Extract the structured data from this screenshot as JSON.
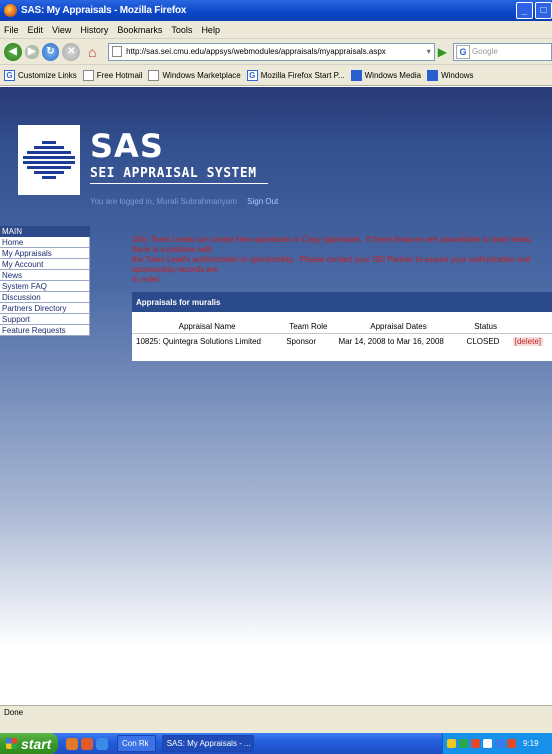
{
  "window": {
    "title": "SAS: My Appraisals - Mozilla Firefox"
  },
  "menu": [
    "File",
    "Edit",
    "View",
    "History",
    "Bookmarks",
    "Tools",
    "Help"
  ],
  "navbar": {
    "url": "http://sas.sei.cmu.edu/appsys/webmodules/appraisals/myappraisals.aspx",
    "search_placeholder": "Google"
  },
  "bookmarks": [
    "Customize Links",
    "Free Hotmail",
    "Windows Marketplace",
    "Mozilla Firefox Start P...",
    "Windows Media",
    "Windows"
  ],
  "header": {
    "brand": "SAS",
    "subtitle": "SEI APPRAISAL SYSTEM",
    "logged_in": "You are logged in, Murali Subrahmanyam",
    "sign_out": "Sign Out"
  },
  "leftnav": {
    "heading": "MAIN",
    "items": [
      "Home",
      "My Appraisals",
      "My Account",
      "News",
      "System FAQ",
      "Discussion",
      "Partners Directory",
      "Support",
      "Feature Requests"
    ]
  },
  "notice": "Only Team Leads can create New appraisals or Copy appraisals.  If these features are unavailable to team leads, there is a problem with\nthe Team Lead's authorization or sponsorship.  Please contact your SEI Partner to assure your authorization and sponsorship records are\nin order.",
  "appraisals": {
    "heading": "Appraisals for muralis",
    "columns": [
      "Appraisal Name",
      "Team Role",
      "Appraisal Dates",
      "Status"
    ],
    "rows": [
      {
        "name": "10825: Quintegra Solutions Limited",
        "role": "Sponsor",
        "dates": "Mar 14, 2008 to Mar 16, 2008",
        "status": "CLOSED",
        "action": "[delete]"
      }
    ]
  },
  "statusbar": {
    "text": "Done"
  },
  "taskbar": {
    "start": "start",
    "task1": "Con Rk",
    "task2": "SAS: My Appraisals - ...",
    "clock": "9:19"
  }
}
